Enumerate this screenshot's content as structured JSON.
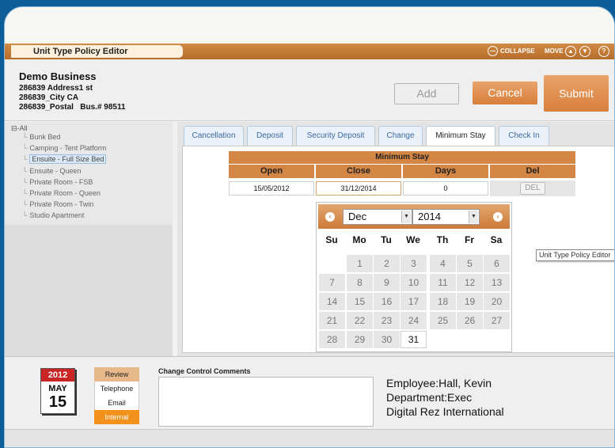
{
  "window": {
    "title": "Unit Type Policy Editor",
    "collapse_label": "COLLAPSE",
    "move_label": "MOVE",
    "help_label": "?"
  },
  "business": {
    "name": "Demo Business",
    "address": "286839 Address1 st",
    "city": "286839_City   CA",
    "postal": "286839_Postal   Bus.# 98511"
  },
  "actions": {
    "add": "Add",
    "cancel": "Cancel",
    "submit": "Submit"
  },
  "tree": {
    "root": "All",
    "items": [
      "Bunk Bed",
      "Camping - Tent Platform",
      "Ensuite - Full Size Bed",
      "Ensuite - Queen",
      "Private Room - FSB",
      "Private Room - Queen",
      "Private Room - Twin",
      "Studio Apartment"
    ],
    "selected": "Ensuite - Full Size Bed"
  },
  "tabs": [
    "Cancellation",
    "Deposit",
    "Security Deposit",
    "Change",
    "Minimum Stay",
    "Check In"
  ],
  "active_tab": "Minimum Stay",
  "grid": {
    "title": "Minimum Stay",
    "columns": [
      "Open",
      "Close",
      "Days",
      "Del"
    ],
    "row": {
      "open": "15/05/2012",
      "close": "31/12/2014",
      "days": "0",
      "del": "DEL"
    }
  },
  "calendar": {
    "prev_icon": "‹",
    "next_icon": "›",
    "month": "Dec",
    "year": "2014",
    "weekdays": [
      "Su",
      "Mo",
      "Tu",
      "We",
      "Th",
      "Fr",
      "Sa"
    ],
    "weeks": [
      [
        "",
        "1",
        "2",
        "3",
        "4",
        "5",
        "6"
      ],
      [
        "7",
        "8",
        "9",
        "10",
        "11",
        "12",
        "13"
      ],
      [
        "14",
        "15",
        "16",
        "17",
        "18",
        "19",
        "20"
      ],
      [
        "21",
        "22",
        "23",
        "24",
        "25",
        "26",
        "27"
      ],
      [
        "28",
        "29",
        "30",
        "31",
        "",
        "",
        ""
      ]
    ],
    "current_day": "31"
  },
  "tooltip": "Unit Type Policy Editor",
  "footer": {
    "date": {
      "year": "2012",
      "month": "MAY",
      "day": "15"
    },
    "contact_types": [
      "Review",
      "Telephone",
      "Email",
      "Internal"
    ],
    "comments_label": "Change Control Comments",
    "comments_value": "",
    "employee": "Employee:Hall, Kevin",
    "department": "Department:Exec",
    "company": "Digital Rez International"
  },
  "colors": {
    "accent": "#d48645",
    "background": "#0d5d98",
    "highlight": "#f2921c",
    "date_red": "#c92525"
  }
}
